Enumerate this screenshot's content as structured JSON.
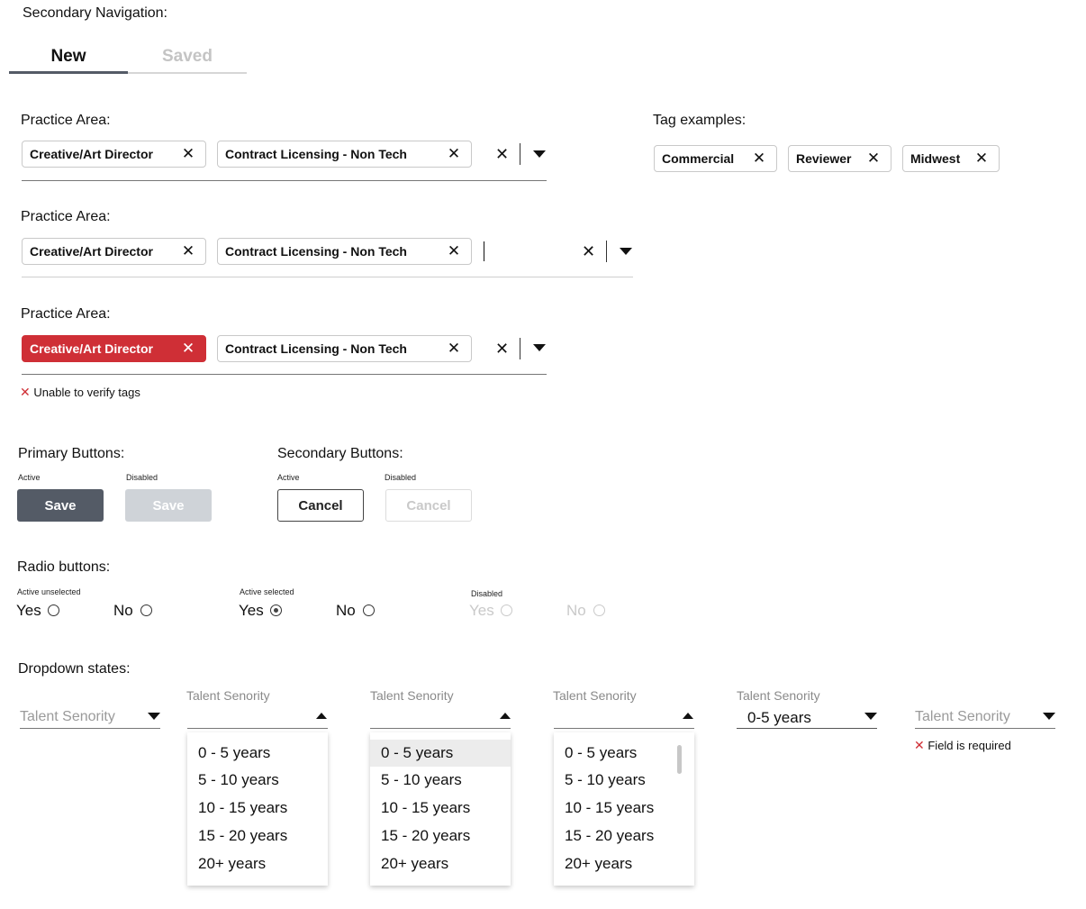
{
  "sections": {
    "secondary_nav": "Secondary Navigation:",
    "practice_area": "Practice Area:",
    "tag_examples": "Tag examples:",
    "primary_buttons": "Primary Buttons:",
    "secondary_buttons": "Secondary Buttons:",
    "radio_buttons": "Radio buttons:",
    "dropdown_states": "Dropdown states:"
  },
  "nav": {
    "tabs": [
      {
        "label": "New",
        "state": "active"
      },
      {
        "label": "Saved",
        "state": "inactive"
      }
    ]
  },
  "practice": {
    "tag1": "Creative/Art Director",
    "tag2": "Contract Licensing - Non Tech",
    "remove": "✕",
    "clear": "✕",
    "error": "Unable to verify tags"
  },
  "tags": [
    "Commercial",
    "Reviewer",
    "Midwest"
  ],
  "buttons": {
    "active": "Active",
    "disabled": "Disabled",
    "save": "Save",
    "cancel": "Cancel"
  },
  "radio": {
    "active_unselected": "Active unselected",
    "active_selected": "Active selected",
    "disabled": "Disabled",
    "yes": "Yes",
    "no": "No"
  },
  "dropdown": {
    "label": "Talent Senority",
    "selected_value": "0-5 years",
    "options": [
      "0 - 5 years",
      "5 - 10 years",
      "10 - 15 years",
      "15 - 20 years",
      "20+ years"
    ],
    "required_error": "Field is required"
  },
  "colors": {
    "error": "#cf2f36",
    "primary_button": "#545b66",
    "disabled_button": "#cfd3d8",
    "nav_active_line": "#545b66",
    "nav_inactive_line": "#d6d6d6"
  }
}
